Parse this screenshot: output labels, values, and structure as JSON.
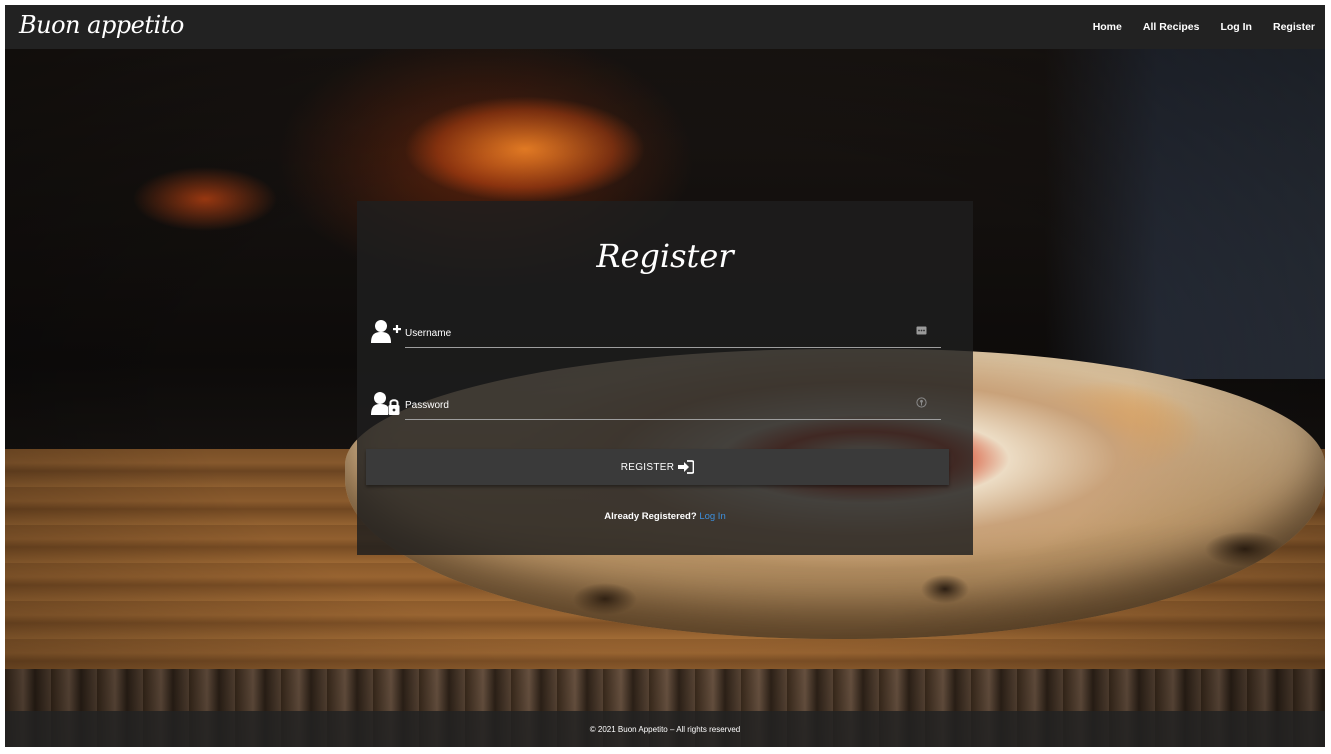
{
  "navbar": {
    "brand": "Buon appetito",
    "links": [
      {
        "label": "Home"
      },
      {
        "label": "All Recipes"
      },
      {
        "label": "Log In"
      },
      {
        "label": "Register"
      }
    ]
  },
  "register_form": {
    "title": "Register",
    "username": {
      "placeholder": "Username",
      "icon": "user-plus-icon",
      "trailing_icon": "password-manager-icon"
    },
    "password": {
      "placeholder": "Password",
      "icon": "user-lock-icon",
      "trailing_icon": "key-icon"
    },
    "submit_label": "REGISTER",
    "submit_icon": "sign-in-icon",
    "already_text": "Already Registered?",
    "login_link": "Log In"
  },
  "footer": {
    "text": "© 2021 Buon Appetito – All rights reserved"
  },
  "colors": {
    "navbar_bg": "#222222",
    "card_bg": "rgba(30,30,30,0.82)",
    "button_bg": "#3a3a3a",
    "link": "#3d8fdc"
  }
}
